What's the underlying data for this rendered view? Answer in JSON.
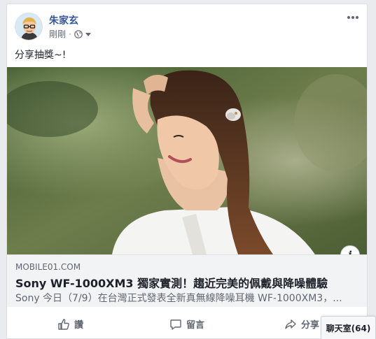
{
  "post": {
    "author": "朱家玄",
    "timestamp": "剛剛",
    "privacy_icon": "globe-icon",
    "more_icon": "ellipsis-icon",
    "status_text": "分享抽獎~!"
  },
  "link_preview": {
    "domain": "MOBILE01.COM",
    "title": "Sony WF-1000XM3 獨家實測！趨近完美的佩戴與降噪體驗",
    "description": "Sony 今日（7/9）在台灣正式發表全新真無線降噪耳機 WF-1000XM3，...",
    "info_label": "i"
  },
  "actions": {
    "like": "讚",
    "comment": "留言",
    "share": "分享"
  },
  "chat": {
    "label": "聊天室(64)"
  }
}
